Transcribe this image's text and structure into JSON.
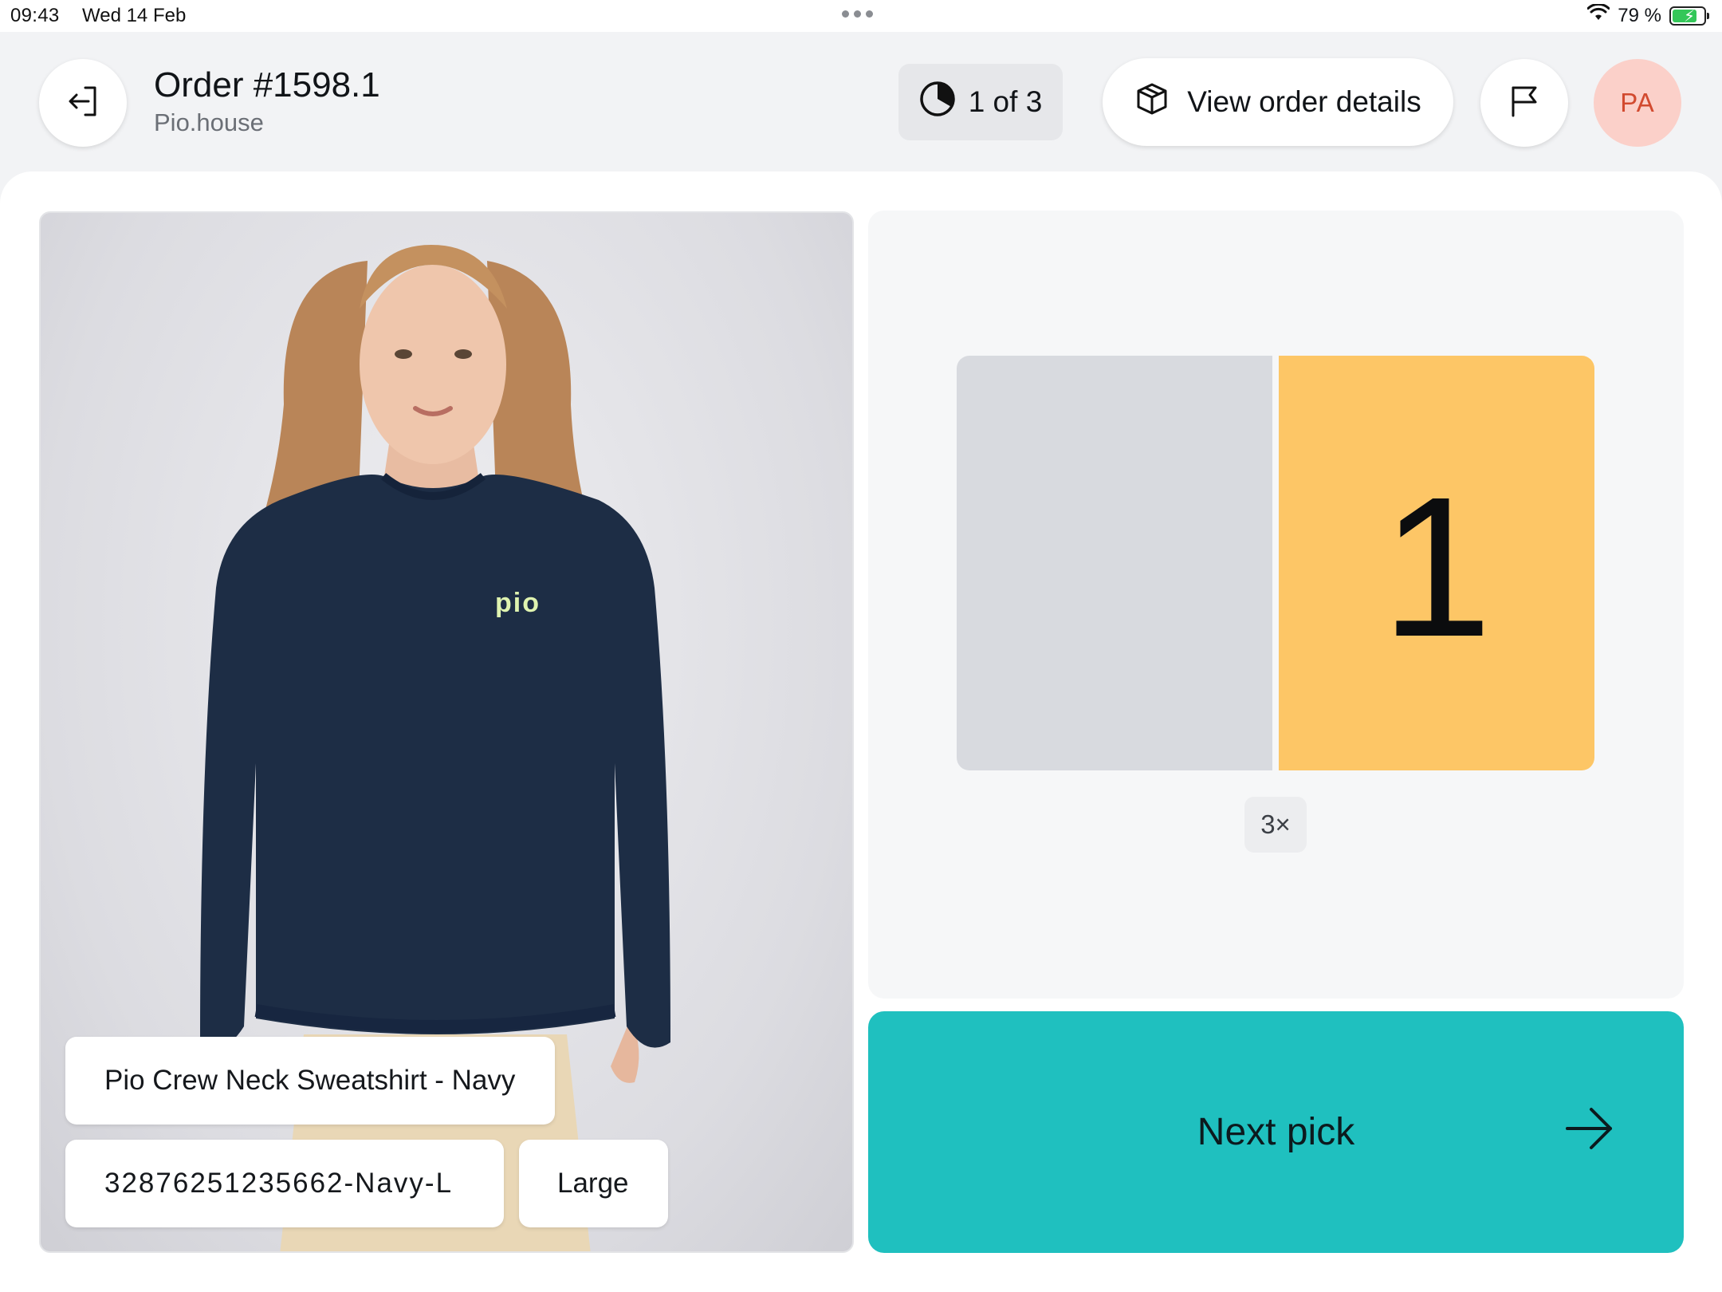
{
  "status_bar": {
    "time": "09:43",
    "date": "Wed 14 Feb",
    "battery": "79 %",
    "battery_level_percent": 79
  },
  "header": {
    "order_title": "Order #1598.1",
    "store_name": "Pio.house",
    "progress": "1 of 3",
    "view_details_label": "View order details",
    "avatar_initials": "PA"
  },
  "product": {
    "name": "Pio Crew Neck Sweatshirt - Navy",
    "sku": "32876251235662-Navy-L",
    "size": "Large",
    "logo_text": "pio"
  },
  "location": {
    "bin_number": "1",
    "quantity": "3×"
  },
  "actions": {
    "next_label": "Next pick"
  },
  "colors": {
    "accent_teal": "#1fc0bf",
    "bin_active": "#fdc666",
    "bin_inactive": "#d8dadf",
    "avatar_bg": "#fbd0c9",
    "avatar_text": "#d24a2f"
  },
  "icons": {
    "back": "logout-arrow-icon",
    "progress": "pie-progress-icon",
    "details": "package-box-icon",
    "flag": "flag-icon",
    "next": "arrow-right-icon"
  }
}
